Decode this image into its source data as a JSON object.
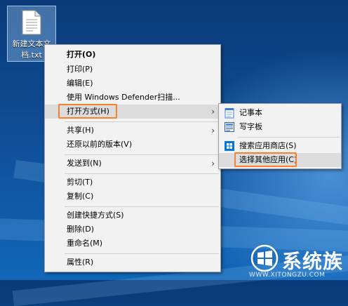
{
  "desktop": {
    "file_label": "新建文本文档.txt"
  },
  "context_menu": {
    "items": [
      {
        "label": "打开(O)"
      },
      {
        "label": "打印(P)"
      },
      {
        "label": "编辑(E)"
      },
      {
        "label": "使用 Windows Defender扫描..."
      },
      {
        "label": "打开方式(H)"
      },
      {
        "label": "共享(H)"
      },
      {
        "label": "还原以前的版本(V)"
      },
      {
        "label": "发送到(N)"
      },
      {
        "label": "剪切(T)"
      },
      {
        "label": "复制(C)"
      },
      {
        "label": "创建快捷方式(S)"
      },
      {
        "label": "删除(D)"
      },
      {
        "label": "重命名(M)"
      },
      {
        "label": "属性(R)"
      }
    ]
  },
  "open_with_submenu": {
    "items": [
      {
        "label": "记事本",
        "icon": "notepad-icon"
      },
      {
        "label": "写字板",
        "icon": "wordpad-icon"
      },
      {
        "label": "搜索应用商店(S)",
        "icon": "store-icon"
      },
      {
        "label": "选择其他应用(C)"
      }
    ]
  },
  "watermark": {
    "site_name": "系统族",
    "url": "WWW.XITONGZU.COM"
  },
  "colors": {
    "highlight_box": "#ff7f27",
    "menu_background": "#f2f2f2",
    "desktop_blue": "#0f4d95"
  }
}
